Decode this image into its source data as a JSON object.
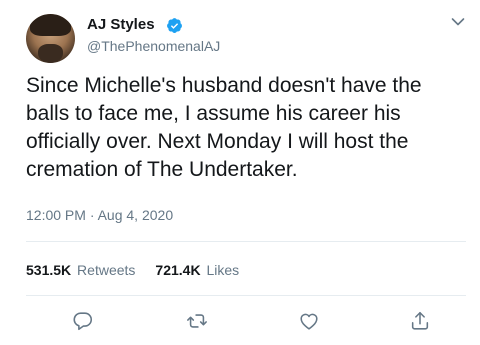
{
  "author": {
    "display_name": "AJ Styles",
    "handle": "@ThePhenomenalAJ",
    "verified": true
  },
  "tweet": {
    "text": "Since Michelle's husband doesn't have the balls to face me, I assume his career his officially over. Next Monday I will host the cremation of The Undertaker.",
    "timestamp": "12:00 PM · Aug 4, 2020"
  },
  "stats": {
    "retweets_count": "531.5K",
    "retweets_label": "Retweets",
    "likes_count": "721.4K",
    "likes_label": "Likes"
  },
  "actions": [
    {
      "icon": "reply-icon"
    },
    {
      "icon": "retweet-icon"
    },
    {
      "icon": "like-icon"
    },
    {
      "icon": "share-icon"
    }
  ],
  "colors": {
    "text_primary": "#14171a",
    "text_secondary": "#657786",
    "verified_blue": "#1da1f2",
    "divider": "#e6ecf0"
  }
}
